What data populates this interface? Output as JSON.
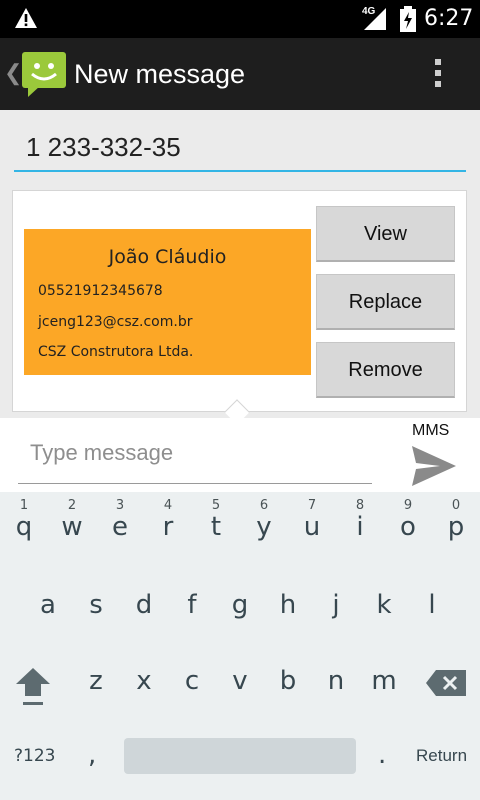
{
  "status_bar": {
    "network_type": "4G",
    "time": "6:27",
    "icons": [
      "warning-icon",
      "signal-icon",
      "battery-charging-icon"
    ]
  },
  "action_bar": {
    "title": "New message",
    "icons": [
      "back-chevron-icon",
      "messaging-app-icon",
      "overflow-menu-icon"
    ]
  },
  "recipient": {
    "value": "1 233-332-35"
  },
  "attachment": {
    "contact": {
      "name": "João Cláudio",
      "phone": "05521912345678",
      "email": "jceng123@csz.com.br",
      "company": "CSZ Construtora Ltda."
    },
    "buttons": {
      "view": "View",
      "replace": "Replace",
      "remove": "Remove"
    },
    "card_color": "#fca726"
  },
  "compose": {
    "placeholder": "Type message",
    "mode_label": "MMS",
    "send_icon": "send-icon"
  },
  "keyboard": {
    "row1": [
      {
        "key": "q",
        "hint": "1"
      },
      {
        "key": "w",
        "hint": "2"
      },
      {
        "key": "e",
        "hint": "3"
      },
      {
        "key": "r",
        "hint": "4"
      },
      {
        "key": "t",
        "hint": "5"
      },
      {
        "key": "y",
        "hint": "6"
      },
      {
        "key": "u",
        "hint": "7"
      },
      {
        "key": "i",
        "hint": "8"
      },
      {
        "key": "o",
        "hint": "9"
      },
      {
        "key": "p",
        "hint": "0"
      }
    ],
    "row2": [
      "a",
      "s",
      "d",
      "f",
      "g",
      "h",
      "j",
      "k",
      "l"
    ],
    "row3": [
      "z",
      "x",
      "c",
      "v",
      "b",
      "n",
      "m"
    ],
    "symbols_label": "?123",
    "comma": ",",
    "period": ".",
    "return_label": "Return"
  },
  "colors": {
    "accent": "#33b5e5",
    "action_bar": "#1e1e1e",
    "keyboard_bg": "#ecf0f1"
  }
}
